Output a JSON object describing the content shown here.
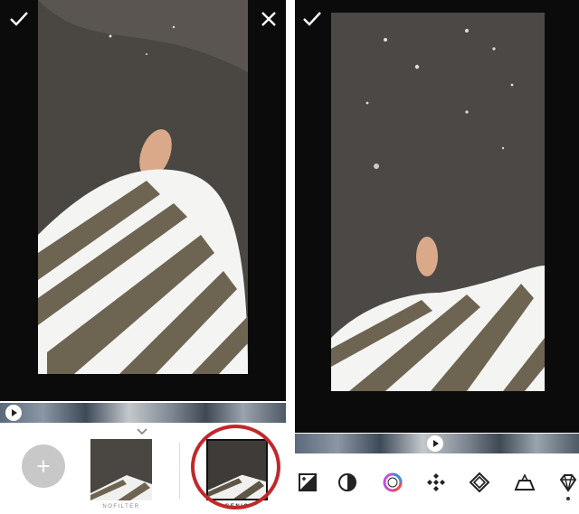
{
  "left_panel": {
    "filters": [
      {
        "label": "NOFILTER"
      },
      {
        "label": "GENIC"
      }
    ],
    "add_label": "+"
  },
  "right_panel": {
    "tools": [
      {
        "icon": "exposure-icon"
      },
      {
        "icon": "contrast-icon"
      },
      {
        "icon": "color-wheel-icon"
      },
      {
        "icon": "sharpen-icon"
      },
      {
        "icon": "clarity-icon"
      },
      {
        "icon": "perspective-icon"
      },
      {
        "icon": "diamond-icon"
      }
    ]
  },
  "colors": {
    "background": "#0b0b0b",
    "highlight_ring": "#c0282a",
    "add_button": "#c8c8c8"
  }
}
